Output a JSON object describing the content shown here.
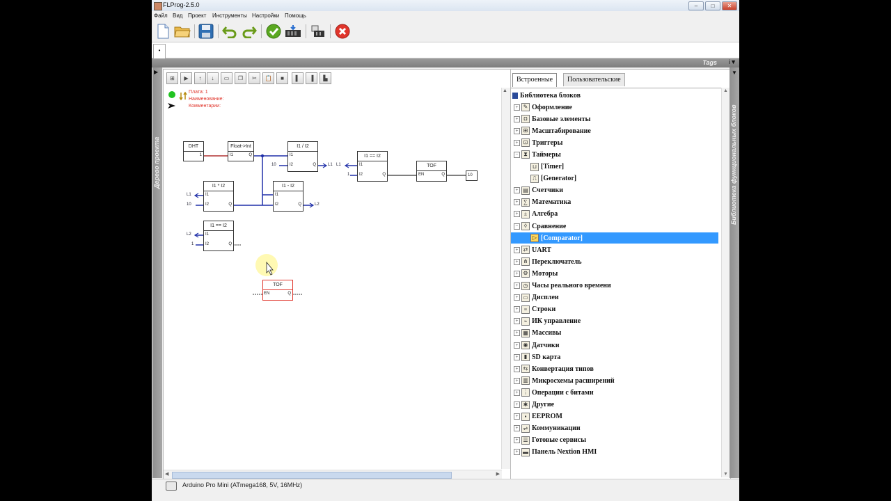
{
  "window": {
    "title": "FLProg-2.5.0"
  },
  "menu": [
    "Файл",
    "Вид",
    "Проект",
    "Инструменты",
    "Настройки",
    "Помощь"
  ],
  "tab": {
    "label": "•"
  },
  "tags_label": "Tags",
  "left_panel_label": "Дерево проекта",
  "right_panel_label": "Библиотека функциональных блоков",
  "board_info": {
    "plate": "Плата: 1",
    "name": "Наименование:",
    "comment": "Комментарии:"
  },
  "blocks": {
    "dht": {
      "title": "DHT",
      "out": "1"
    },
    "float_int": {
      "title": "Float->Int",
      "in": "I1",
      "out": "Q"
    },
    "div": {
      "title": "I1 / I2",
      "in1": "I1",
      "in2": "I2",
      "out": "Q",
      "in2_val": "10",
      "out_sig": "L1"
    },
    "eq1": {
      "title": "I1 == I2",
      "in1": "I1",
      "in2": "I2",
      "out": "Q",
      "in1_sig": "L1",
      "in2_val": "1"
    },
    "tof1": {
      "title": "TOF",
      "in": "EN",
      "out": "Q",
      "out_val": "10"
    },
    "mul": {
      "title": "I1 * I2",
      "in1": "I1",
      "in2": "I2",
      "out": "Q",
      "in1_sig": "L1",
      "in2_val": "10"
    },
    "sub": {
      "title": "I1 - I2",
      "in1": "I1",
      "in2": "I2",
      "out": "Q",
      "out_sig": "L2"
    },
    "eq2": {
      "title": "I1 == I2",
      "in1": "I1",
      "in2": "I2",
      "out": "Q",
      "in1_sig": "L2",
      "in2_val": "1"
    },
    "tof2": {
      "title": "TOF",
      "in": "EN",
      "out": "Q"
    }
  },
  "library": {
    "tabs": [
      "Встроенные",
      "Пользовательские"
    ],
    "root": "Библиотека блоков",
    "items": [
      {
        "label": "Оформление",
        "icon": "design-icon",
        "level": 1,
        "exp": "+"
      },
      {
        "label": "Базовые элементы",
        "icon": "basic-elements-icon",
        "level": 1,
        "exp": "+"
      },
      {
        "label": "Масштабирование",
        "icon": "scaling-icon",
        "level": 1,
        "exp": "+"
      },
      {
        "label": "Триггеры",
        "icon": "triggers-icon",
        "level": 1,
        "exp": "+"
      },
      {
        "label": "Таймеры",
        "icon": "timers-icon",
        "level": 1,
        "exp": "−"
      },
      {
        "label": "[Timer]",
        "icon": "timer-icon",
        "level": 2,
        "exp": ""
      },
      {
        "label": "[Generator]",
        "icon": "generator-icon",
        "level": 2,
        "exp": ""
      },
      {
        "label": "Счетчики",
        "icon": "counters-icon",
        "level": 1,
        "exp": "+"
      },
      {
        "label": "Математика",
        "icon": "math-icon",
        "level": 1,
        "exp": "+"
      },
      {
        "label": "Алгебра",
        "icon": "algebra-icon",
        "level": 1,
        "exp": "+"
      },
      {
        "label": "Сравнение",
        "icon": "comparison-icon",
        "level": 1,
        "exp": "−"
      },
      {
        "label": "[Comparator]",
        "icon": "comparator-icon",
        "level": 2,
        "exp": "",
        "selected": true
      },
      {
        "label": "UART",
        "icon": "uart-icon",
        "level": 1,
        "exp": "+"
      },
      {
        "label": "Переключатель",
        "icon": "switch-icon",
        "level": 1,
        "exp": "+"
      },
      {
        "label": "Моторы",
        "icon": "motors-icon",
        "level": 1,
        "exp": "+"
      },
      {
        "label": "Часы реального времени",
        "icon": "rtc-icon",
        "level": 1,
        "exp": "+"
      },
      {
        "label": "Дисплеи",
        "icon": "displays-icon",
        "level": 1,
        "exp": "+"
      },
      {
        "label": "Строки",
        "icon": "strings-icon",
        "level": 1,
        "exp": "+"
      },
      {
        "label": "ИК управление",
        "icon": "ir-control-icon",
        "level": 1,
        "exp": "+"
      },
      {
        "label": "Массивы",
        "icon": "arrays-icon",
        "level": 1,
        "exp": "+"
      },
      {
        "label": "Датчики",
        "icon": "sensors-icon",
        "level": 1,
        "exp": "+"
      },
      {
        "label": "SD карта",
        "icon": "sd-card-icon",
        "level": 1,
        "exp": "+"
      },
      {
        "label": "Конвертация типов",
        "icon": "type-conversion-icon",
        "level": 1,
        "exp": "+"
      },
      {
        "label": "Микросхемы расширений",
        "icon": "expansion-chips-icon",
        "level": 1,
        "exp": "+"
      },
      {
        "label": "Операции с битами",
        "icon": "bit-ops-icon",
        "level": 1,
        "exp": "+"
      },
      {
        "label": "Другие",
        "icon": "other-icon",
        "level": 1,
        "exp": "+"
      },
      {
        "label": "EEPROM",
        "icon": "eeprom-icon",
        "level": 1,
        "exp": "+"
      },
      {
        "label": "Коммуникации",
        "icon": "communications-icon",
        "level": 1,
        "exp": "+"
      },
      {
        "label": "Готовые сервисы",
        "icon": "services-icon",
        "level": 1,
        "exp": "+"
      },
      {
        "label": "Панель Nextion HMI",
        "icon": "nextion-icon",
        "level": 1,
        "exp": "+"
      }
    ]
  },
  "status": {
    "board": "Arduino Pro Mini (ATmega168, 5V, 16MHz)"
  },
  "colors": {
    "selection": "#3399ff",
    "wire_blue": "#1f2fa8",
    "wire_red": "#b03030",
    "accent_red": "#e0352b"
  }
}
